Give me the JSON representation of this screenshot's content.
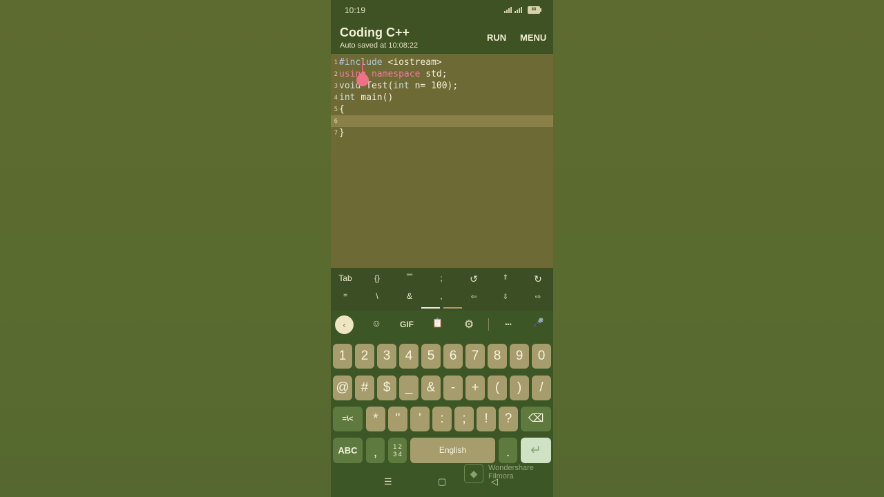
{
  "status_bar": {
    "time": "10:19",
    "battery": "88"
  },
  "app_bar": {
    "title": "Coding C++",
    "subtitle": "Auto saved at 10:08:22",
    "run_label": "RUN",
    "menu_label": "MENU"
  },
  "editor": {
    "lines": [
      {
        "num": "1",
        "tokens": [
          {
            "t": "#include ",
            "c": "kw-inc"
          },
          {
            "t": "<iostream>",
            "c": ""
          }
        ]
      },
      {
        "num": "2",
        "tokens": [
          {
            "t": "using ",
            "c": "kw-pink"
          },
          {
            "t": "namespace ",
            "c": "kw-pink"
          },
          {
            "t": "std;",
            "c": ""
          }
        ]
      },
      {
        "num": "3",
        "tokens": [
          {
            "t": "void ",
            "c": "kw-type"
          },
          {
            "t": "Test(",
            "c": ""
          },
          {
            "t": "int ",
            "c": "kw-type"
          },
          {
            "t": "n= 100);",
            "c": ""
          }
        ]
      },
      {
        "num": "4",
        "tokens": [
          {
            "t": "int ",
            "c": "kw-type"
          },
          {
            "t": "main()",
            "c": ""
          }
        ]
      },
      {
        "num": "5",
        "tokens": [
          {
            "t": "{",
            "c": ""
          }
        ]
      },
      {
        "num": "6",
        "tokens": []
      },
      {
        "num": "7",
        "tokens": [
          {
            "t": "}",
            "c": ""
          }
        ]
      }
    ],
    "active_line": "6"
  },
  "symbol_bar": {
    "row1": [
      "Tab",
      "{}",
      "\"\"",
      ";",
      "↺",
      "⇑",
      "↻"
    ],
    "row2": [
      "=",
      "\\",
      "&",
      ",",
      "⇦",
      "⇩",
      "⇨"
    ]
  },
  "keyboard": {
    "toolbar": {
      "back": "‹",
      "sticker": "☺",
      "gif": "GIF",
      "clipboard": "📋",
      "settings": "⚙",
      "more": "•••",
      "mic": "🎤"
    },
    "row_numbers": [
      "1",
      "2",
      "3",
      "4",
      "5",
      "6",
      "7",
      "8",
      "9",
      "0"
    ],
    "row_symbols1": [
      "@",
      "#",
      "$",
      "_",
      "&",
      "-",
      "+",
      "(",
      ")",
      "/"
    ],
    "row_symbols2": {
      "toggle": "=\\<",
      "keys": [
        "*",
        "\"",
        "'",
        ":",
        ";",
        "!",
        "?"
      ],
      "backspace": "⌫"
    },
    "bottom": {
      "abc": "ABC",
      "comma": ",",
      "numpad_top": "1 2",
      "numpad_bottom": "3 4",
      "space": "English",
      "period": ".",
      "enter": "↵"
    }
  },
  "nav_bar": {
    "menu": "☰",
    "home": "▢",
    "back": "◁"
  },
  "watermark": {
    "line1": "Wondershare",
    "line2": "Filmora"
  }
}
